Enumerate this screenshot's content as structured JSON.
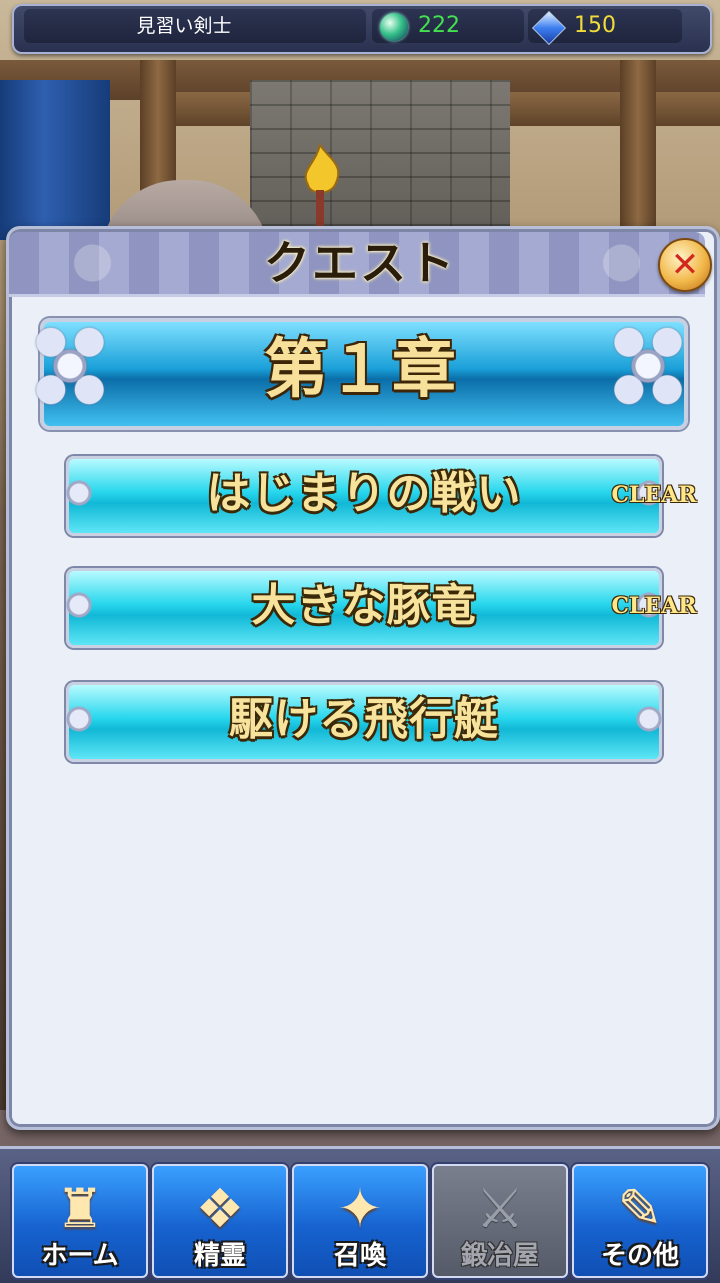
{
  "status_bar": {
    "player_name": "見習い剣士",
    "spirit_stones": "222",
    "crystals": "150",
    "stone_icon": "green-gem-icon",
    "crystal_icon": "blue-crystal-icon"
  },
  "dialog": {
    "title": "クエスト",
    "close_icon": "close-icon",
    "chapter": "第１章",
    "stages": [
      {
        "label": "はじまりの戦い",
        "status": "CLEAR"
      },
      {
        "label": "大きな豚竜",
        "status": "CLEAR"
      },
      {
        "label": "駆ける飛行艇",
        "status": ""
      }
    ]
  },
  "nav": {
    "items": [
      {
        "label": "ホーム",
        "icon": "castle-icon",
        "enabled": true
      },
      {
        "label": "精霊",
        "icon": "spirit-book-icon",
        "enabled": true
      },
      {
        "label": "召喚",
        "icon": "summon-book-icon",
        "enabled": true
      },
      {
        "label": "鍛冶屋",
        "icon": "blacksmith-icon",
        "enabled": false
      },
      {
        "label": "その他",
        "icon": "scroll-quill-icon",
        "enabled": true
      }
    ]
  },
  "colors": {
    "stone_value": "#43e04f",
    "crystal_value": "#f2dc3a",
    "chapter_banner": "#1aa0d8",
    "stage_button": "#27d6ec",
    "gold_text": "#f7e09a",
    "close_button": "#f2b84a"
  }
}
